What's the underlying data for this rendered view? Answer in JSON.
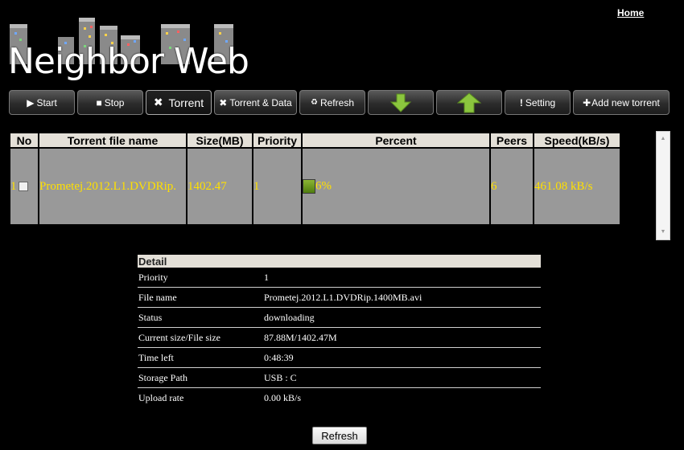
{
  "header": {
    "home_link": "Home",
    "logo_text": "Neighbor Web"
  },
  "toolbar": {
    "start": "Start",
    "stop": "Stop",
    "torrent": "Torrent",
    "torrent_data": "Torrent & Data",
    "refresh": "Refresh",
    "setting": "Setting",
    "add_new": "Add new torrent"
  },
  "table": {
    "columns": [
      "No",
      "Torrent file name",
      "Size(MB)",
      "Priority",
      "Percent",
      "Peers",
      "Speed(kB/s)"
    ],
    "rows": [
      {
        "no": "1",
        "name": "Prometej.2012.L1.DVDRip.",
        "size": "1402.47",
        "priority": "1",
        "percent_text": "6%",
        "percent_value": 6,
        "peers": "6",
        "speed": "461.08 kB/s"
      }
    ]
  },
  "detail": {
    "title": "Detail",
    "rows": [
      {
        "label": "Priority",
        "value": "1"
      },
      {
        "label": "File name",
        "value": "Prometej.2012.L1.DVDRip.1400MB.avi"
      },
      {
        "label": "Status",
        "value": "downloading"
      },
      {
        "label": "Current size/File size",
        "value": "87.88M/1402.47M"
      },
      {
        "label": "Time left",
        "value": "0:48:39"
      },
      {
        "label": "Storage Path",
        "value": "USB : C"
      },
      {
        "label": "Upload rate",
        "value": "0.00 kB/s"
      }
    ]
  },
  "footer": {
    "refresh": "Refresh"
  },
  "colors": {
    "accent_yellow": "#ffe000",
    "row_bg": "#999999",
    "header_bg": "#e4e0d8",
    "arrow_green": "#8bc63e"
  }
}
